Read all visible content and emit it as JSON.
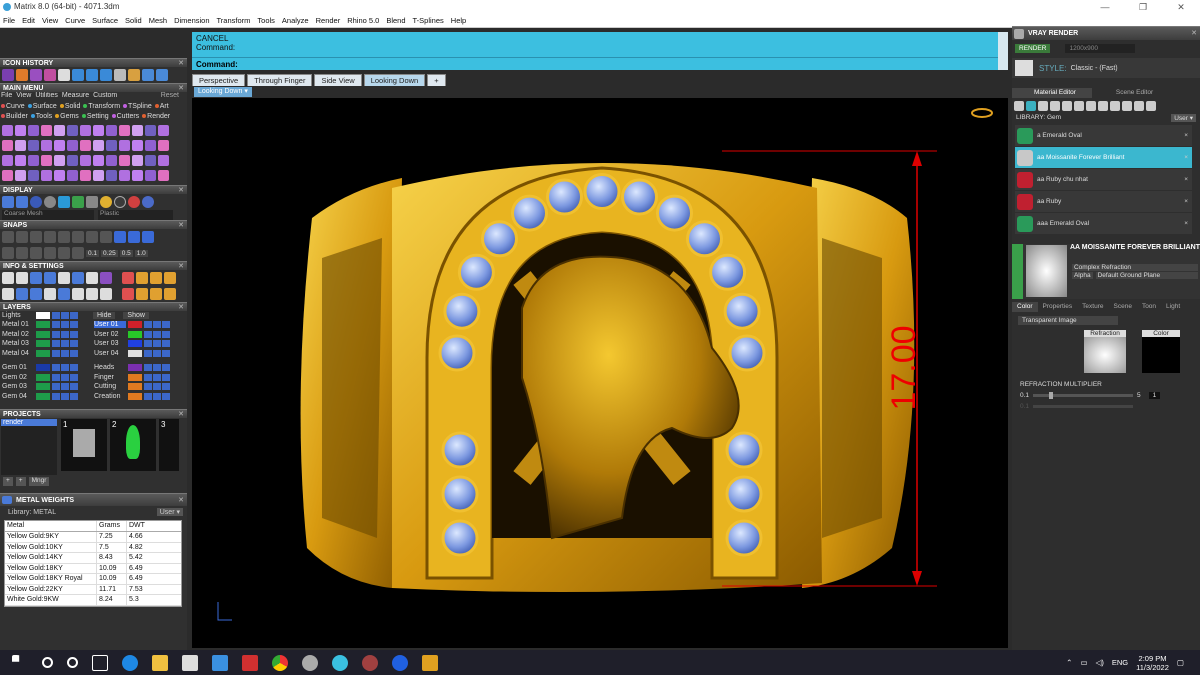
{
  "window": {
    "title": "Matrix 8.0 (64-bit) - 4071.3dm"
  },
  "menu": [
    "File",
    "Edit",
    "View",
    "Curve",
    "Surface",
    "Solid",
    "Mesh",
    "Dimension",
    "Transform",
    "Tools",
    "Analyze",
    "Render",
    "Rhino 5.0",
    "Blend",
    "T-Splines",
    "Help"
  ],
  "left": {
    "icon_history": "ICON HISTORY",
    "main_menu": "MAIN MENU",
    "main_menu_items": [
      "File",
      "View",
      "Utilities",
      "Measure",
      "Custom"
    ],
    "reset": "Reset",
    "builder_row1": [
      "Curve",
      "Surface",
      "Solid",
      "Transform",
      "TSpline",
      "Art"
    ],
    "builder_row2": [
      "Builder",
      "Tools",
      "Gems",
      "Setting",
      "Cutters",
      "Render"
    ],
    "display": "DISPLAY",
    "display_mode1": "Coarse Mesh",
    "display_mode2": "Plastic",
    "snaps": "SNAPS",
    "snap_values": [
      "0.1",
      "0.25",
      "0.5",
      "1.0"
    ],
    "info": "INFO & SETTINGS",
    "layers": "LAYERS",
    "lights": "Lights",
    "hide": "Hide",
    "show": "Show",
    "layer_left": [
      {
        "name": "Metal 01",
        "color": "#1e9c4a"
      },
      {
        "name": "Metal 02",
        "color": "#1e9c4a"
      },
      {
        "name": "Metal 03",
        "color": "#1e9c4a"
      },
      {
        "name": "Metal 04",
        "color": "#1e9c4a"
      },
      {
        "name": "Gem 01",
        "color": "#1a3aa8"
      },
      {
        "name": "Gem 02",
        "color": "#1e9c4a"
      },
      {
        "name": "Gem 03",
        "color": "#1e9c4a"
      },
      {
        "name": "Gem 04",
        "color": "#1e9c4a"
      }
    ],
    "layer_right": [
      {
        "name": "User 01",
        "color": "#d0202a"
      },
      {
        "name": "User 02",
        "color": "#28c828"
      },
      {
        "name": "User 03",
        "color": "#2040e0"
      },
      {
        "name": "User 04",
        "color": "#e0e0e0"
      },
      {
        "name": "Heads",
        "color": "#7b2fb0"
      },
      {
        "name": "Finger",
        "color": "#e07a20"
      },
      {
        "name": "Cutting",
        "color": "#e07a20"
      },
      {
        "name": "Creation",
        "color": "#e07a20"
      }
    ],
    "projects": "PROJECTS",
    "project_name": "render",
    "project_nums": [
      "1",
      "2",
      "3"
    ],
    "mngr": "Mngr",
    "metal_weights": "METAL WEIGHTS",
    "library": "Library: METAL",
    "table_headers": [
      "Metal",
      "Grams",
      "DWT"
    ],
    "table_rows": [
      [
        "Yellow Gold:9KY",
        "7.25",
        "4.66"
      ],
      [
        "Yellow Gold:10KY",
        "7.5",
        "4.82"
      ],
      [
        "Yellow Gold:14KY",
        "8.43",
        "5.42"
      ],
      [
        "Yellow Gold:18KY",
        "10.09",
        "6.49"
      ],
      [
        "Yellow Gold:18KY Royal",
        "10.09",
        "6.49"
      ],
      [
        "Yellow Gold:22KY",
        "11.71",
        "7.53"
      ],
      [
        "White Gold:9KW",
        "8.24",
        "5.3"
      ]
    ]
  },
  "command": {
    "line1": "CANCEL",
    "line2": "Command:",
    "prompt": "Command:"
  },
  "tabs": [
    "Perspective",
    "Through Finger",
    "Side View",
    "Looking Down"
  ],
  "active_tab": "Looking Down",
  "viewport_label": "Looking Down",
  "dimension": "17.00",
  "right": {
    "title": "VRAY RENDER",
    "render_btn": "RENDER",
    "resolution": "1200x900",
    "style_label": "STYLE:",
    "style_value": "Classic - (Fast)",
    "tab_material": "Material Editor",
    "tab_scene": "Scene Editor",
    "library": "LIBRARY: Gem",
    "materials": [
      {
        "name": "a Emerald Oval",
        "color": "#2a9a5a"
      },
      {
        "name": "aa Moissanite Forever Brilliant",
        "color": "#c8c8c8"
      },
      {
        "name": "aa Ruby chu nhat",
        "color": "#c02030"
      },
      {
        "name": "aa Ruby",
        "color": "#c02030"
      },
      {
        "name": "aaa Emerald Oval",
        "color": "#2a9a5a"
      }
    ],
    "selected_material": "AA MOISSANITE FOREVER BRILLIANT",
    "complex_refraction": "Complex Refraction",
    "alpha": "Alpha",
    "ground_plane": "Default Ground Plane",
    "subtabs": [
      "Color",
      "Properties",
      "Texture",
      "Scene",
      "Toon",
      "Light"
    ],
    "transparent_image": "Transparent Image",
    "refraction": "Refraction",
    "color": "Color",
    "refraction_multiplier": "REFRACTION MULTIPLIER",
    "rm_min": "0.1",
    "rm_max": "5",
    "rm_val": "1",
    "ior_min": "0.1"
  },
  "taskbar": {
    "lang": "ENG",
    "time": "2:09 PM",
    "date": "11/3/2022"
  }
}
